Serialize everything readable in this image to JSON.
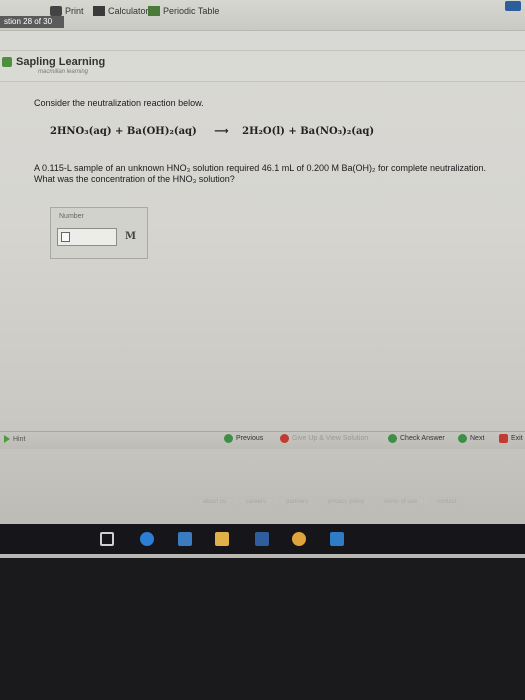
{
  "toolbar": {
    "print_label": "Print",
    "calculator_label": "Calculator",
    "periodic_table_label": "Periodic Table",
    "question_nav": "stion 28 of 30"
  },
  "brand": {
    "name": "Sapling Learning",
    "sub": "macmillan learning"
  },
  "question": {
    "intro": "Consider the neutralization reaction below.",
    "equation_left": "2HNO₃(aq) + Ba(OH)₂(aq)",
    "equation_arrow": "⟶",
    "equation_right": "2H₂O(l) + Ba(NO₃)₂(aq)",
    "prompt": "A 0.115-L sample of an unknown HNO₃ solution required 46.1 mL of 0.200 M Ba(OH)₂ for complete neutralization. What was the concentration of the HNO₃ solution?"
  },
  "answer": {
    "label": "Number",
    "value": "",
    "unit": "M"
  },
  "actions": {
    "hint": "Hint",
    "previous": "Previous",
    "give_up": "Give Up & View Solution",
    "check_answer": "Check Answer",
    "next": "Next",
    "exit": "Exit"
  },
  "footer": {
    "links": [
      "about us",
      "careers",
      "partners",
      "privacy policy",
      "terms of use",
      "contact"
    ]
  },
  "colors": {
    "accent_green": "#3e8f45",
    "danger_red": "#c23b32"
  }
}
